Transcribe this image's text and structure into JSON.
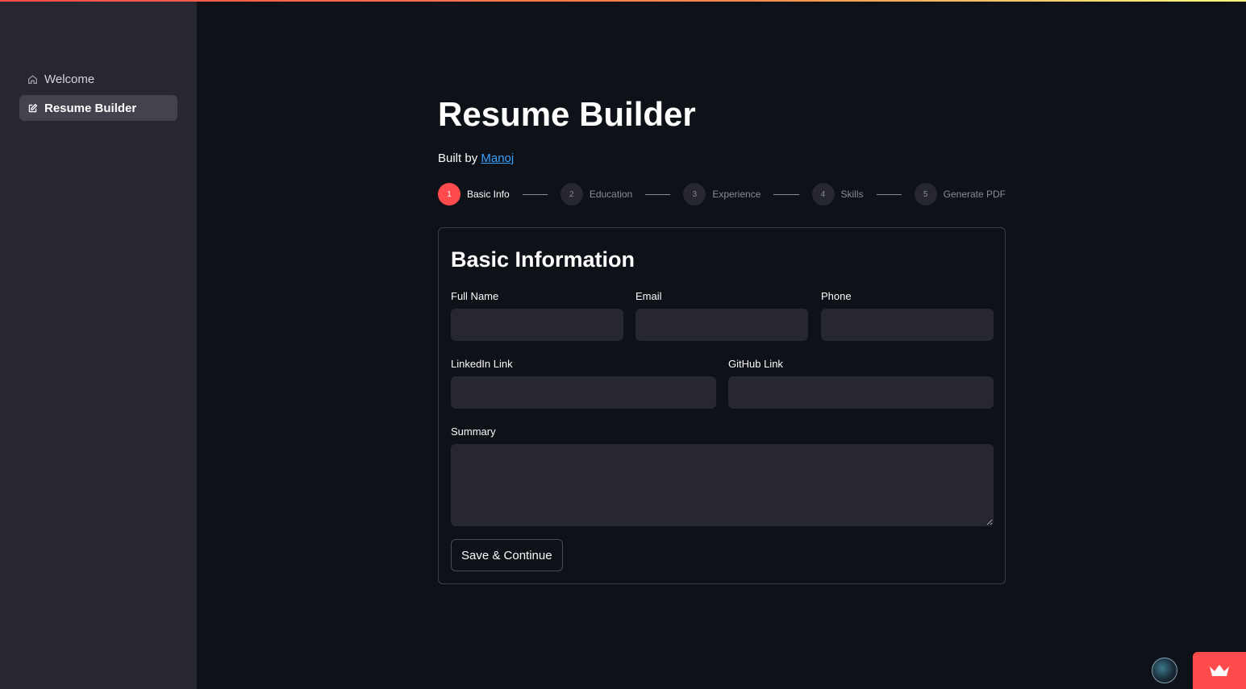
{
  "sidebar": {
    "items": [
      {
        "label": "Welcome",
        "icon": "home-icon",
        "active": false
      },
      {
        "label": "Resume Builder",
        "icon": "edit-icon",
        "active": true
      }
    ]
  },
  "header": {
    "title": "Resume Builder",
    "built_by_prefix": "Built by",
    "author_link": "Manoj"
  },
  "stepper": {
    "steps": [
      {
        "number": "1",
        "label": "Basic Info",
        "active": true
      },
      {
        "number": "2",
        "label": "Education",
        "active": false
      },
      {
        "number": "3",
        "label": "Experience",
        "active": false
      },
      {
        "number": "4",
        "label": "Skills",
        "active": false
      },
      {
        "number": "5",
        "label": "Generate PDF",
        "active": false
      }
    ]
  },
  "form": {
    "title": "Basic Information",
    "full_name": {
      "label": "Full Name",
      "value": "",
      "placeholder": ""
    },
    "email": {
      "label": "Email",
      "value": "",
      "placeholder": ""
    },
    "phone": {
      "label": "Phone",
      "value": "",
      "placeholder": ""
    },
    "linkedin": {
      "label": "LinkedIn Link",
      "value": "",
      "placeholder": ""
    },
    "github": {
      "label": "GitHub Link",
      "value": "",
      "placeholder": ""
    },
    "summary": {
      "label": "Summary",
      "value": "",
      "placeholder": ""
    },
    "save_label": "Save & Continue"
  },
  "footer": {
    "avatar_icon": "user-avatar-icon",
    "badge_icon": "crown-icon"
  },
  "colors": {
    "accent": "#ff4b4b",
    "background": "#0e1117",
    "sidebar": "#262730",
    "link": "#3ca2ff"
  }
}
